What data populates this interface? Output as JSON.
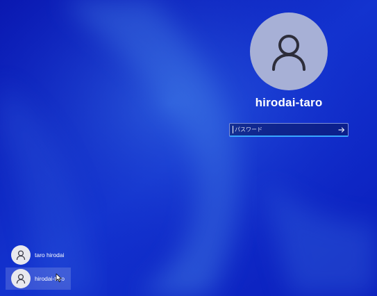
{
  "login": {
    "username": "hirodai-taro",
    "password_placeholder": "パスワード"
  },
  "user_list": {
    "users": [
      {
        "name": "taro hirodai"
      },
      {
        "name": "hirodai-taro"
      }
    ]
  },
  "icons": {
    "large_avatar": "person-icon",
    "submit": "arrow-right-icon",
    "list_avatar": "person-icon",
    "pointer": "mouse-cursor-icon"
  },
  "colors": {
    "background": "#0b1fc4",
    "input_accent": "#39a7ff",
    "avatar_bg": "#a7b0d6"
  }
}
